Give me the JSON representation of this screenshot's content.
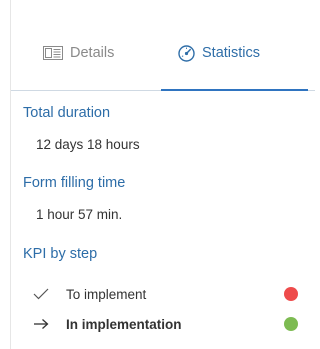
{
  "tabs": {
    "details_label": "Details",
    "statistics_label": "Statistics",
    "active": "Statistics"
  },
  "total_duration": {
    "title": "Total duration",
    "value": "12 days 18 hours"
  },
  "form_filling_time": {
    "title": "Form filling time",
    "value": "1 hour 57 min."
  },
  "kpi": {
    "title": "KPI by step",
    "steps": [
      {
        "label": "To implement",
        "status_icon": "check-icon",
        "indicator_color": "#ee4b4b"
      },
      {
        "label": "In implementation",
        "status_icon": "arrow-right-icon",
        "indicator_color": "#7dbb52",
        "current": true
      }
    ]
  },
  "colors": {
    "accent": "#2f74c0",
    "section_title": "#2d6da8",
    "inactive_tab": "#8a8a8a"
  }
}
